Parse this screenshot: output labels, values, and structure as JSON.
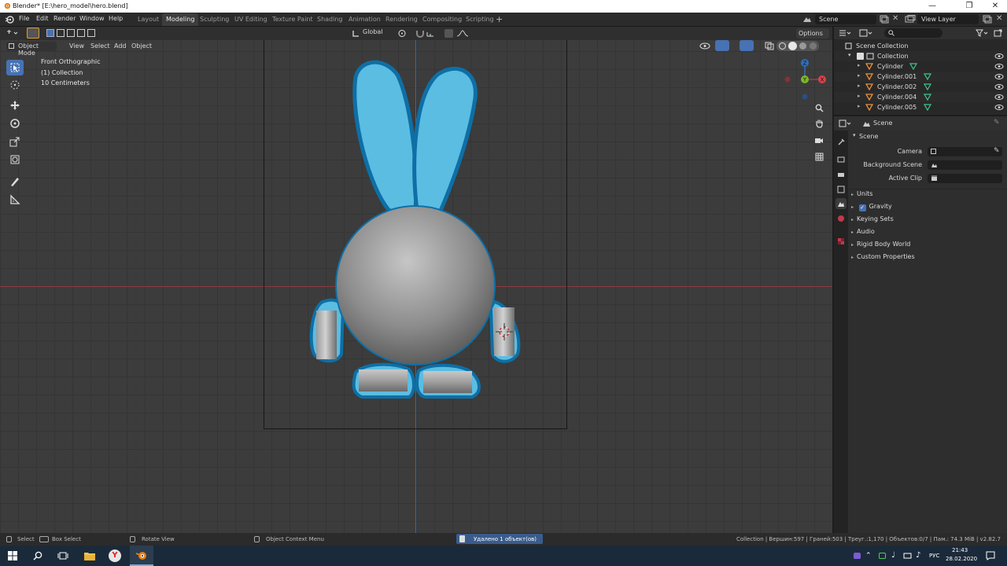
{
  "titlebar": {
    "title": "Blender* [E:\\hero_model\\hero.blend]",
    "minimize": "—",
    "maximize": "❐",
    "close": "✕"
  },
  "menu": {
    "file": "File",
    "edit": "Edit",
    "render": "Render",
    "window": "Window",
    "help": "Help"
  },
  "workspaces": [
    "Layout",
    "Modeling",
    "Sculpting",
    "UV Editing",
    "Texture Paint",
    "Shading",
    "Animation",
    "Rendering",
    "Compositing",
    "Scripting"
  ],
  "active_workspace": "Modeling",
  "scene_selector": {
    "label": "Scene"
  },
  "view_layer": {
    "label": "View Layer"
  },
  "toolbar": {
    "orientation": "Global",
    "options": "Options"
  },
  "viewport_header": {
    "mode": "Object Mode",
    "view": "View",
    "select": "Select",
    "add": "Add",
    "object": "Object"
  },
  "viewport_overlay": {
    "view_name": "Front Orthographic",
    "collection": "(1) Collection",
    "scale": "10 Centimeters"
  },
  "gizmo": {
    "z": "Z",
    "y": "Y",
    "x": "X"
  },
  "outliner": {
    "root": "Scene Collection",
    "collection": "Collection",
    "objects": [
      "Cylinder",
      "Cylinder.001",
      "Cylinder.002",
      "Cylinder.004",
      "Cylinder.005"
    ]
  },
  "properties": {
    "header": "Scene",
    "panel": "Scene",
    "camera_label": "Camera",
    "background_label": "Background Scene",
    "clip_label": "Active Clip",
    "sections": [
      "Units",
      "Gravity",
      "Keying Sets",
      "Audio",
      "Rigid Body World",
      "Custom Properties"
    ]
  },
  "status": {
    "select": "Select",
    "box_select": "Box Select",
    "rotate_view": "Rotate View",
    "context_menu": "Object Context Menu",
    "message": "Удалено 1 объект(ов)",
    "stats": "Collection | Вершин:597 | Граней:503 | Треуг.:1,170 | Объектов:0/7 | Пам.: 74.3 MiB | v2.82.7"
  },
  "taskbar": {
    "lang": "РУС",
    "time": "21:43",
    "date": "28.02.2020"
  },
  "colors": {
    "accent": "#4772b3",
    "outline": "#0e6fa6",
    "ears": "#5bbde2",
    "xaxis": "#a33a44",
    "yaxis": "#6a9c2a",
    "zaxis": "#3a6fb0"
  }
}
